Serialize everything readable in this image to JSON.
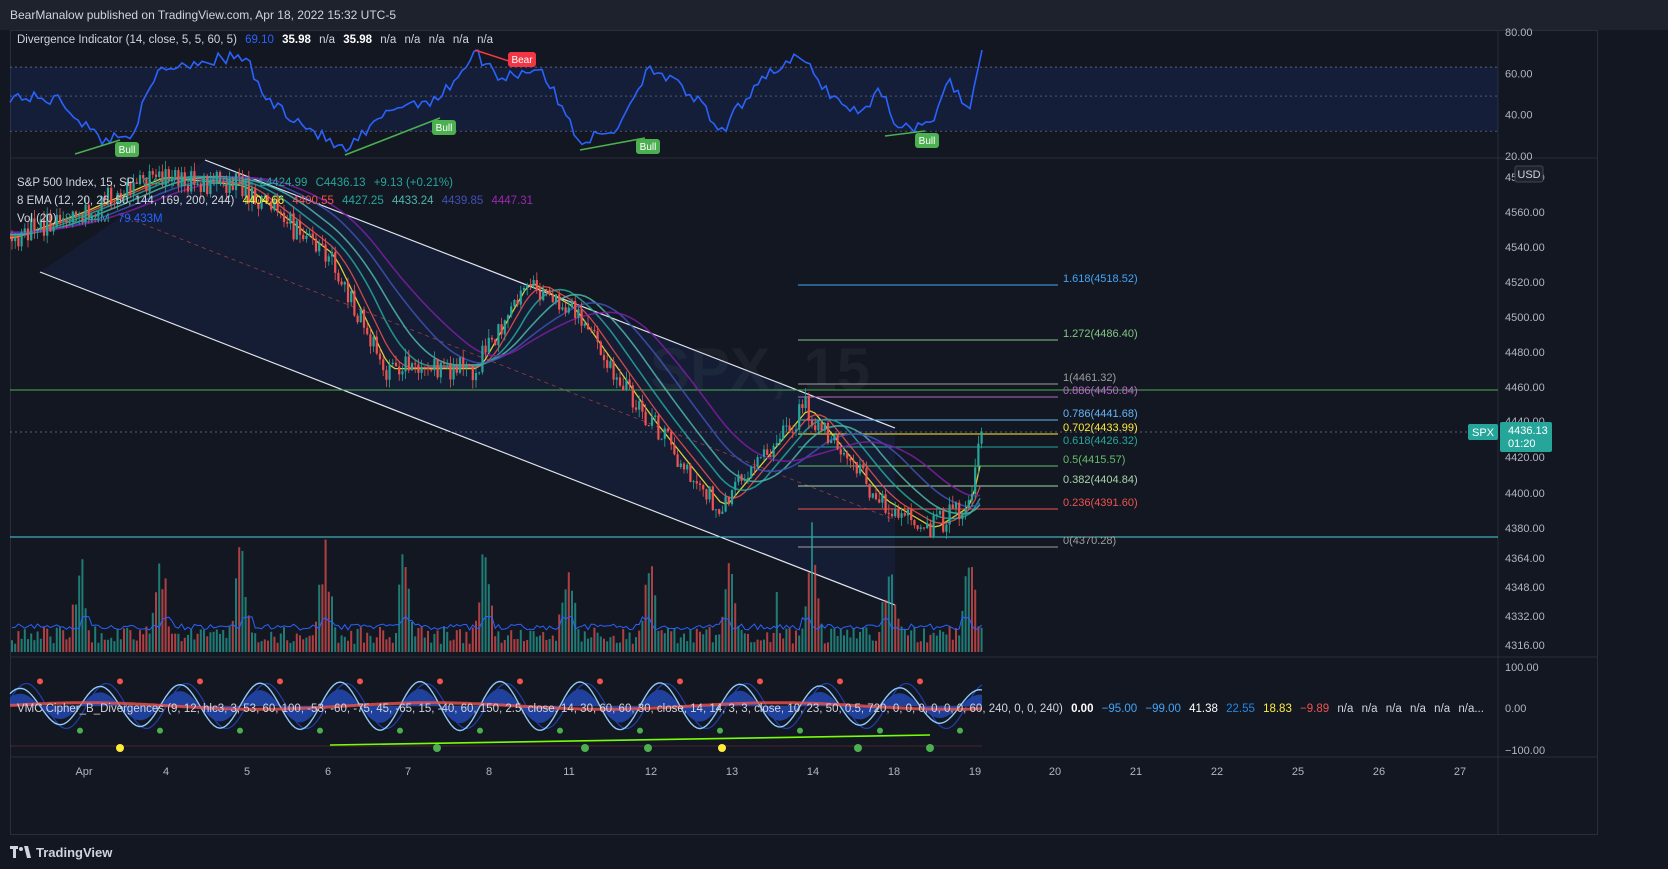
{
  "header": {
    "published": "BearManalow published on TradingView.com, Apr 18, 2022 15:32 UTC-5"
  },
  "footer": {
    "brand": "TradingView"
  },
  "colors": {
    "bg": "#131722",
    "up": "#26a69a",
    "down": "#ef5350",
    "osc": "#2962ff",
    "bull": "#4caf50",
    "bear": "#f23645"
  },
  "divergence": {
    "title": "Divergence Indicator (14, close, 5, 5, 60, 5)",
    "values": [
      "69.10",
      "35.98",
      "n/a",
      "35.98",
      "n/a",
      "n/a",
      "n/a",
      "n/a",
      "n/a"
    ],
    "axis": [
      "80.00",
      "60.00",
      "40.00",
      "20.00"
    ],
    "labels": {
      "bull": "Bull",
      "bear": "Bear"
    }
  },
  "price": {
    "symbol_line": [
      "S&P 500 Index, 15, SP",
      "O4427.15",
      "H4438.96",
      "L4424.99",
      "C4436.13",
      "+9.13 (+0.21%)"
    ],
    "ema_line": [
      "8 EMA (12, 20, 26, 50, 144, 169, 200, 244)",
      "4404.66",
      "4400.55",
      "4427.25",
      "4433.24",
      "4439.85",
      "4447.31"
    ],
    "vol_line": [
      "Vol (20)",
      "86.544M",
      "79.433M"
    ],
    "currency": "USD",
    "axis": [
      "4580.00",
      "4560.00",
      "4540.00",
      "4520.00",
      "4500.00",
      "4480.00",
      "4460.00",
      "4440.00",
      "4420.00",
      "4400.00",
      "4380.00",
      "4364.00",
      "4348.00",
      "4332.00",
      "4316.00"
    ],
    "last_tag": {
      "symbol": "SPX",
      "price": "4436.13",
      "countdown": "01:20"
    },
    "watermark": "SPX, 15",
    "fib_levels": [
      {
        "label": "1.618(4518.52)",
        "color": "#42a5f5"
      },
      {
        "label": "1.272(4486.40)",
        "color": "#81c784"
      },
      {
        "label": "1(4461.32)",
        "color": "#9e9e9e"
      },
      {
        "label": "0.886(4450.84)",
        "color": "#ba68c8"
      },
      {
        "label": "0.786(4441.68)",
        "color": "#64b5f6"
      },
      {
        "label": "0.702(4433.99)",
        "color": "#ffeb3b"
      },
      {
        "label": "0.618(4426.32)",
        "color": "#26a69a"
      },
      {
        "label": "0.5(4415.57)",
        "color": "#66bb6a"
      },
      {
        "label": "0.382(4404.84)",
        "color": "#a5d6a7"
      },
      {
        "label": "0.236(4391.60)",
        "color": "#ef5350"
      },
      {
        "label": "0(4370.28)",
        "color": "#9e9e9e"
      }
    ]
  },
  "cipher": {
    "title": "VMC Cipher_B_Divergences (9, 12, hlc3, 3, 53, 60, 100, -53, -60, -75, 45, -65, 15, -40, 60, 150, 2.5, close, 14, 30, 60, 60, 30, close, 14, 14, 3, 3, close, 10, 23, 50, 0.5, 720, 0, 0, 0, 0, 0, 0, 60, 240, 0, 0, 240)",
    "values": [
      "0.00",
      "−95.00",
      "−99.00",
      "41.38",
      "22.55",
      "18.83",
      "−9.89",
      "n/a",
      "n/a",
      "n/a",
      "n/a",
      "n/a",
      "n/a..."
    ],
    "axis": [
      "100.00",
      "0.00",
      "−100.00"
    ]
  },
  "time_axis": [
    "Apr",
    "4",
    "5",
    "6",
    "7",
    "8",
    "11",
    "12",
    "13",
    "14",
    "18",
    "19",
    "20",
    "21",
    "22",
    "25",
    "26",
    "27"
  ],
  "chart_data": {
    "type": "line",
    "title": "S&P 500 Index, 15",
    "x": [
      "Apr",
      "4",
      "5",
      "6",
      "7",
      "8",
      "11",
      "12",
      "13",
      "14",
      "18",
      "19"
    ],
    "series": [
      {
        "name": "S&P 500 Index",
        "values": [
          4545,
          4590,
          4575,
          4500,
          4490,
          4515,
          4450,
          4435,
          4395,
          4445,
          4380,
          4436
        ]
      }
    ],
    "ylim": [
      4310,
      4590
    ],
    "fibonacci": [
      4518.52,
      4486.4,
      4461.32,
      4450.84,
      4441.68,
      4433.99,
      4426.32,
      4415.57,
      4404.84,
      4391.6,
      4370.28
    ]
  }
}
